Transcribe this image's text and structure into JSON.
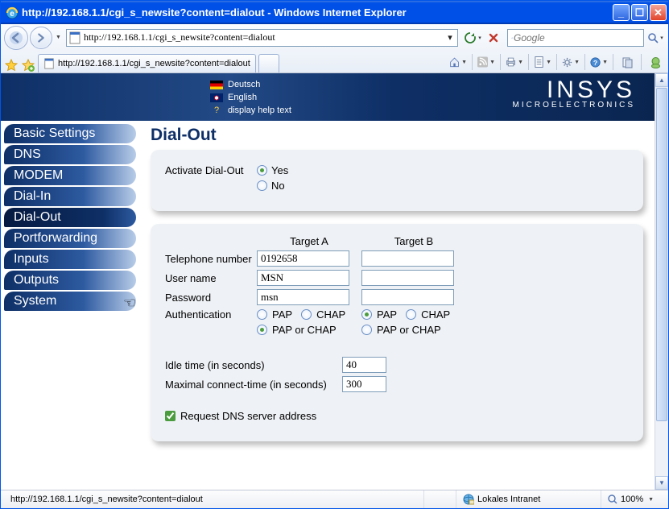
{
  "window": {
    "title": "http://192.168.1.1/cgi_s_newsite?content=dialout - Windows Internet Explorer"
  },
  "addressbar": {
    "url": "http://192.168.1.1/cgi_s_newsite?content=dialout"
  },
  "search": {
    "placeholder": "Google"
  },
  "tab": {
    "label": "http://192.168.1.1/cgi_s_newsite?content=dialout"
  },
  "banner": {
    "lang_de": "Deutsch",
    "lang_en": "English",
    "help": "display help text",
    "logo_big": "INSYS",
    "logo_small": "MICROELECTRONICS"
  },
  "nav": {
    "items": [
      "Basic Settings",
      "DNS",
      "MODEM",
      "Dial-In",
      "Dial-Out",
      "Portforwarding",
      "Inputs",
      "Outputs",
      "System"
    ],
    "active_index": 4
  },
  "page": {
    "title": "Dial-Out",
    "activate_label": "Activate Dial-Out",
    "yes": "Yes",
    "no": "No",
    "target_a": "Target A",
    "target_b": "Target B",
    "telephone_label": "Telephone number",
    "telephone_a": "0192658",
    "telephone_b": "",
    "username_label": "User name",
    "username_a": "MSN",
    "username_b": "",
    "password_label": "Password",
    "password_a": "msn",
    "password_b": "",
    "auth_label": "Authentication",
    "pap": "PAP",
    "chap": "CHAP",
    "pap_or_chap": "PAP or CHAP",
    "idle_label": "Idle time (in seconds)",
    "idle_value": "40",
    "maxconn_label": "Maximal connect-time (in seconds)",
    "maxconn_value": "300",
    "reqdns_label": "Request DNS server address"
  },
  "status": {
    "url": "http://192.168.1.1/cgi_s_newsite?content=dialout",
    "zone": "Lokales Intranet",
    "zoom": "100%"
  }
}
